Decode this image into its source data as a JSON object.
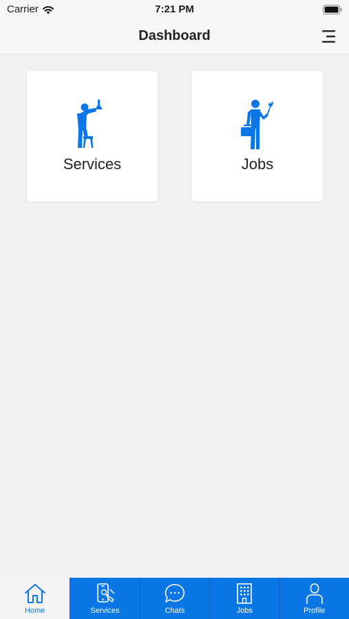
{
  "status_bar": {
    "carrier": "Carrier",
    "time": "7:21 PM"
  },
  "header": {
    "title": "Dashboard",
    "menu_icon": "menu-icon"
  },
  "cards": [
    {
      "label": "Services",
      "icon": "worker-on-stool-icon"
    },
    {
      "label": "Jobs",
      "icon": "worker-with-toolbox-icon"
    }
  ],
  "tab_bar": {
    "tabs": [
      {
        "label": "Home",
        "icon": "home-icon",
        "active": true
      },
      {
        "label": "Services",
        "icon": "phone-service-icon",
        "active": false
      },
      {
        "label": "Chats",
        "icon": "chat-icon",
        "active": false
      },
      {
        "label": "Jobs",
        "icon": "building-icon",
        "active": false
      },
      {
        "label": "Profile",
        "icon": "user-icon",
        "active": false
      }
    ]
  },
  "colors": {
    "accent": "#0b76e6",
    "background": "#f1f1f1",
    "card": "#ffffff"
  }
}
